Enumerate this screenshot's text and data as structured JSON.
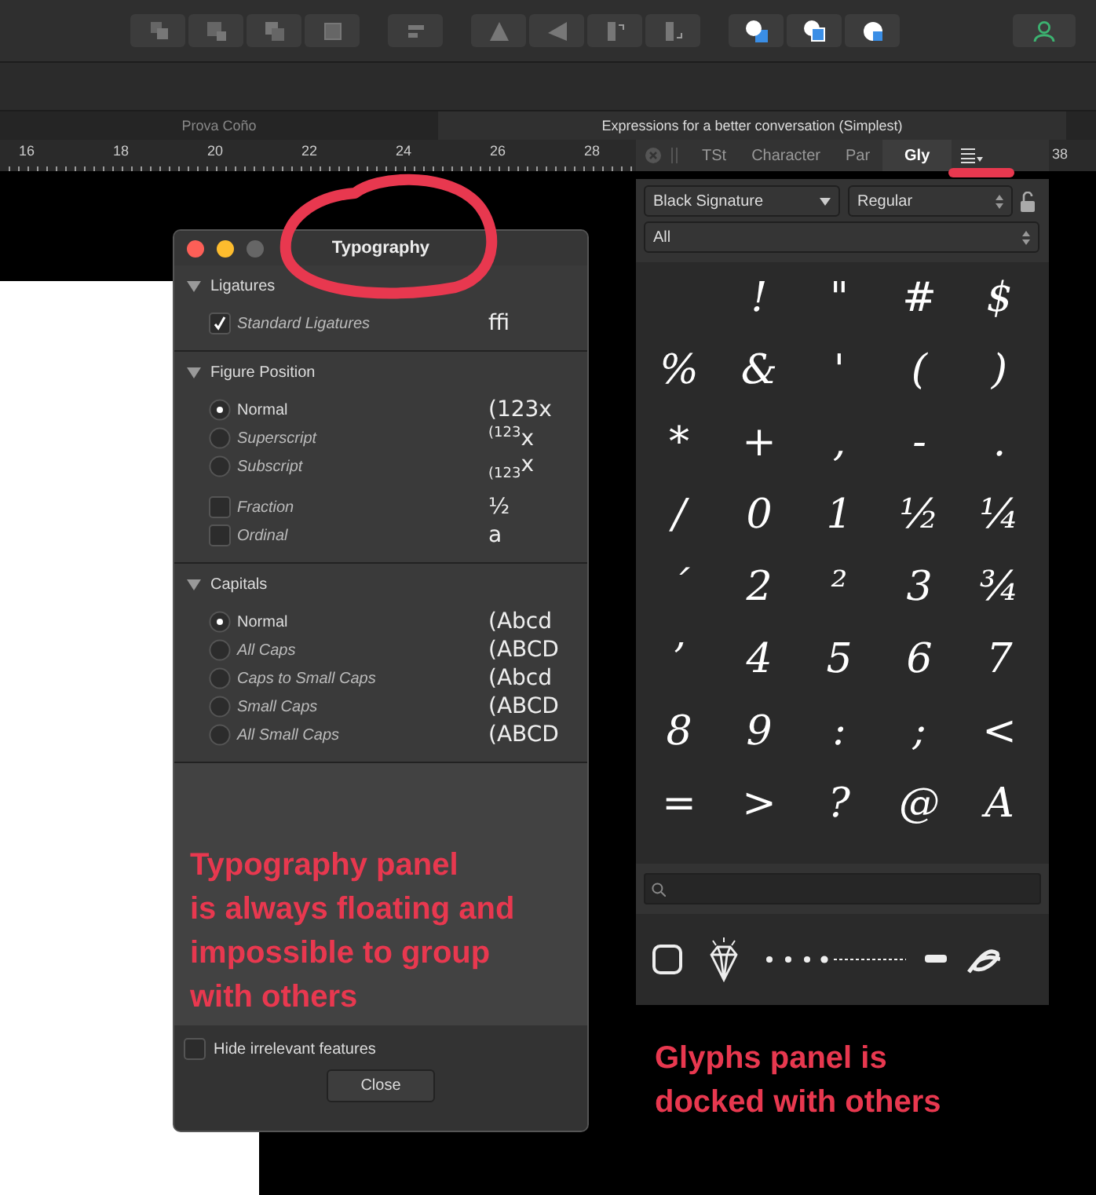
{
  "document_tabs": [
    {
      "label": "Prova Coño",
      "selected": false
    },
    {
      "label": "Expressions for a better conversation (Simplest)",
      "selected": true
    }
  ],
  "ruler": {
    "labels": [
      "16",
      "18",
      "20",
      "22",
      "24",
      "26",
      "28"
    ],
    "end_label": "38"
  },
  "typography_panel": {
    "title": "Typography",
    "sections": [
      {
        "title": "Ligatures",
        "expanded": true,
        "items": [
          {
            "kind": "checkbox",
            "label": "Standard Ligatures",
            "checked": true,
            "available": false,
            "preview": "ffi"
          }
        ]
      },
      {
        "title": "Figure Position",
        "expanded": true,
        "items": [
          {
            "kind": "radio",
            "label": "Normal",
            "selected": true,
            "available": true,
            "preview": "(123x"
          },
          {
            "kind": "radio",
            "label": "Superscript",
            "selected": false,
            "available": false,
            "preview": "$^{(123}$x"
          },
          {
            "kind": "radio",
            "label": "Subscript",
            "selected": false,
            "available": false,
            "preview": "$_{(123}$x"
          },
          {
            "kind": "checkbox",
            "label": "Fraction",
            "checked": false,
            "available": false,
            "preview": "½"
          },
          {
            "kind": "checkbox",
            "label": "Ordinal",
            "checked": false,
            "available": false,
            "preview": "a"
          }
        ]
      },
      {
        "title": "Capitals",
        "expanded": true,
        "items": [
          {
            "kind": "radio",
            "label": "Normal",
            "selected": true,
            "available": true,
            "preview": "(Abcd"
          },
          {
            "kind": "radio",
            "label": "All Caps",
            "selected": false,
            "available": false,
            "preview": "(ABCD"
          },
          {
            "kind": "radio",
            "label": "Caps to Small Caps",
            "selected": false,
            "available": false,
            "preview": "(Abcd"
          },
          {
            "kind": "radio",
            "label": "Small Caps",
            "selected": false,
            "available": false,
            "preview": "(ABCD"
          },
          {
            "kind": "radio",
            "label": "All Small Caps",
            "selected": false,
            "available": false,
            "preview": "(ABCD"
          }
        ]
      }
    ],
    "hide_irrelevant": {
      "label": "Hide irrelevant features",
      "checked": false
    },
    "close_button": "Close"
  },
  "glyphs_panel": {
    "tabs": [
      {
        "label": "TSt",
        "selected": false
      },
      {
        "label": "Character",
        "selected": false
      },
      {
        "label": "Par",
        "selected": false
      },
      {
        "label": "Gly",
        "selected": true
      }
    ],
    "font": "Black Signature",
    "style": "Regular",
    "category": "All",
    "glyphs": [
      {
        "kind": "space"
      },
      {
        "kind": "glyph",
        "char": "!"
      },
      {
        "kind": "glyph",
        "char": "\""
      },
      {
        "kind": "glyph",
        "char": "#"
      },
      {
        "kind": "glyph",
        "char": "$"
      },
      {
        "kind": "glyph",
        "char": "%"
      },
      {
        "kind": "glyph",
        "char": "&"
      },
      {
        "kind": "glyph",
        "char": "'"
      },
      {
        "kind": "glyph",
        "char": "("
      },
      {
        "kind": "glyph",
        "char": ")"
      },
      {
        "kind": "glyph",
        "char": "*"
      },
      {
        "kind": "glyph",
        "char": "+"
      },
      {
        "kind": "glyph",
        "char": ","
      },
      {
        "kind": "glyph",
        "char": "-"
      },
      {
        "kind": "glyph",
        "char": "."
      },
      {
        "kind": "glyph",
        "char": "/"
      },
      {
        "kind": "glyph",
        "char": "0"
      },
      {
        "kind": "glyph",
        "char": "1"
      },
      {
        "kind": "glyph",
        "char": "½"
      },
      {
        "kind": "glyph",
        "char": "¼"
      },
      {
        "kind": "glyph",
        "char": "´"
      },
      {
        "kind": "glyph",
        "char": "2"
      },
      {
        "kind": "glyph",
        "char": "²"
      },
      {
        "kind": "glyph",
        "char": "3"
      },
      {
        "kind": "glyph",
        "char": "¾"
      },
      {
        "kind": "glyph",
        "char": "’"
      },
      {
        "kind": "glyph",
        "char": "4"
      },
      {
        "kind": "glyph",
        "char": "5"
      },
      {
        "kind": "glyph",
        "char": "6"
      },
      {
        "kind": "glyph",
        "char": "7"
      },
      {
        "kind": "glyph",
        "char": "8"
      },
      {
        "kind": "glyph",
        "char": "9"
      },
      {
        "kind": "glyph",
        "char": ":"
      },
      {
        "kind": "glyph",
        "char": ";"
      },
      {
        "kind": "glyph",
        "char": "<"
      },
      {
        "kind": "glyph",
        "char": "="
      },
      {
        "kind": "glyph",
        "char": ">"
      },
      {
        "kind": "glyph",
        "char": "?"
      },
      {
        "kind": "glyph",
        "char": "@"
      },
      {
        "kind": "glyph",
        "char": "A"
      }
    ]
  },
  "annotations": [
    {
      "lines": [
        "Typography panel",
        "is always floating and",
        "impossible to group",
        "with others"
      ]
    },
    {
      "lines": [
        "Glyphs panel is",
        "docked with others"
      ]
    }
  ]
}
